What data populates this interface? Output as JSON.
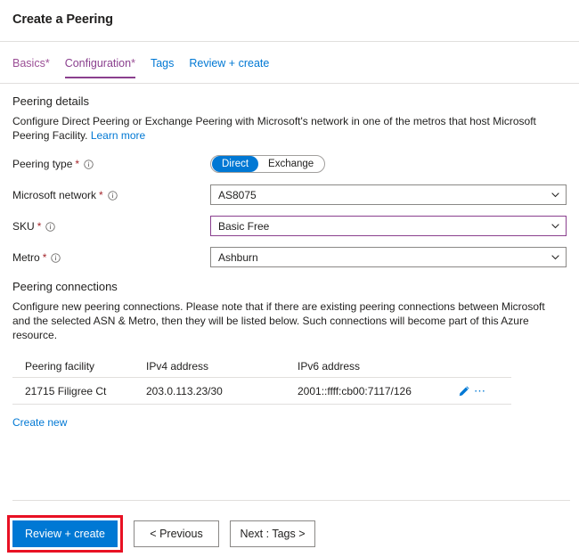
{
  "header": {
    "title": "Create a Peering"
  },
  "tabs": [
    {
      "label": "Basics",
      "required": "*",
      "state": "visited",
      "name": "tab-basics"
    },
    {
      "label": "Configuration",
      "required": "*",
      "state": "active",
      "name": "tab-configuration"
    },
    {
      "label": "Tags",
      "required": "",
      "state": "default",
      "name": "tab-tags"
    },
    {
      "label": "Review + create",
      "required": "",
      "state": "default",
      "name": "tab-review-create"
    }
  ],
  "peering_details": {
    "heading": "Peering details",
    "description": "Configure Direct Peering or Exchange Peering with Microsoft's network in one of the metros that host Microsoft Peering Facility.",
    "learn_more": "Learn more",
    "peering_type": {
      "label": "Peering type",
      "required": "*",
      "options": [
        "Direct",
        "Exchange"
      ],
      "selected": "Direct"
    },
    "microsoft_network": {
      "label": "Microsoft network",
      "required": "*",
      "value": "AS8075"
    },
    "sku": {
      "label": "SKU",
      "required": "*",
      "value": "Basic Free"
    },
    "metro": {
      "label": "Metro",
      "required": "*",
      "value": "Ashburn"
    }
  },
  "peering_connections": {
    "heading": "Peering connections",
    "description": "Configure new peering connections. Please note that if there are existing peering connections between Microsoft and the selected ASN & Metro, then they will be listed below. Such connections will become part of this Azure resource.",
    "columns": [
      "Peering facility",
      "IPv4 address",
      "IPv6 address"
    ],
    "rows": [
      {
        "facility": "21715 Filigree Ct",
        "ipv4": "203.0.113.23/30",
        "ipv6": "2001::ffff:cb00:7117/126"
      }
    ],
    "create_new": "Create new"
  },
  "footer": {
    "review_create": "Review + create",
    "previous": "< Previous",
    "next": "Next : Tags >"
  },
  "colors": {
    "accent_blue": "#0078d4",
    "accent_purple": "#8a3f8e",
    "required_red": "#a4262c",
    "highlight_red": "#e81123",
    "border_grey": "#8a8886",
    "divider_grey": "#e1dfdd"
  }
}
